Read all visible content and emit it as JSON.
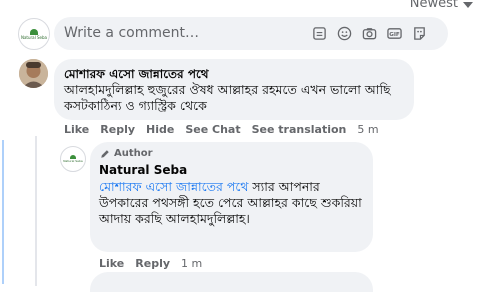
{
  "sort": {
    "label": "Newest"
  },
  "composer": {
    "placeholder": "Write a comment…",
    "page_logo_text": "Natural Seba",
    "icons": [
      "sticker-icon",
      "emoji-icon",
      "camera-icon",
      "gif-icon",
      "avatar-sticker-icon"
    ]
  },
  "comments": [
    {
      "author": "মোশারফ এসো জান্নাতের পথে",
      "text": "আলহামদুলিল্লাহ হুজুরের ঔষধ আল্লাহর রহমতে এখন ভালো আছি কসটকাঠিন্য ও গ্যাস্ট্রিক থেকে",
      "actions": {
        "like": "Like",
        "reply": "Reply",
        "hide": "Hide",
        "see_chat": "See Chat",
        "translate": "See translation",
        "time": "5 m"
      }
    }
  ],
  "reply": {
    "badge": "Author",
    "author": "Natural Seba",
    "mention": "মোশারফ এসো জান্নাতের পথে",
    "text": " স্যার আপনার উপকারের পথসঙ্গী হতে পেরে আল্লাহর কাছে শুকরিয়া আদায় করছি আলহামদুলিল্লাহ।",
    "actions": {
      "like": "Like",
      "reply": "Reply",
      "time": "1 m"
    }
  },
  "colors": {
    "link": "#1877f2",
    "bubble": "#f0f2f5",
    "muted": "#65676b"
  }
}
